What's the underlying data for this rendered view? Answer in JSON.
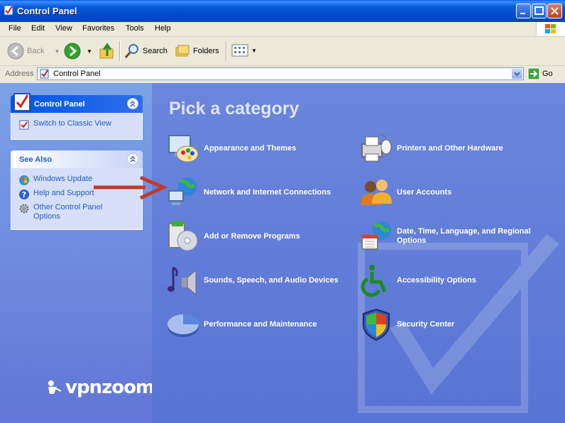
{
  "window": {
    "title": "Control Panel"
  },
  "menu": {
    "items": [
      "File",
      "Edit",
      "View",
      "Favorites",
      "Tools",
      "Help"
    ]
  },
  "toolbar": {
    "back_label": "Back",
    "search_label": "Search",
    "folders_label": "Folders"
  },
  "address": {
    "label": "Address",
    "value": "Control Panel",
    "go_label": "Go"
  },
  "sidebar": {
    "control_panel": {
      "title": "Control Panel",
      "switch_label": "Switch to Classic View"
    },
    "see_also": {
      "title": "See Also",
      "items": [
        {
          "label": "Windows Update",
          "icon": "windows-update-icon"
        },
        {
          "label": "Help and Support",
          "icon": "help-icon"
        },
        {
          "label": "Other Control Panel Options",
          "icon": "gear-icon"
        }
      ]
    }
  },
  "main": {
    "heading": "Pick a category",
    "categories": [
      {
        "label": "Appearance and Themes",
        "icon": "appearance-icon"
      },
      {
        "label": "Printers and Other Hardware",
        "icon": "printer-icon"
      },
      {
        "label": "Network and Internet Connections",
        "icon": "network-icon"
      },
      {
        "label": "User Accounts",
        "icon": "users-icon"
      },
      {
        "label": "Add or Remove Programs",
        "icon": "programs-icon"
      },
      {
        "label": "Date, Time, Language, and Regional Options",
        "icon": "datetime-icon"
      },
      {
        "label": "Sounds, Speech, and Audio Devices",
        "icon": "sound-icon"
      },
      {
        "label": "Accessibility Options",
        "icon": "accessibility-icon"
      },
      {
        "label": "Performance and Maintenance",
        "icon": "performance-icon"
      },
      {
        "label": "Security Center",
        "icon": "shield-icon"
      }
    ]
  },
  "watermark": {
    "text": "vpnzoom"
  },
  "colors": {
    "titlebar": "#0A5BDB",
    "link": "#215DC6",
    "content_bg": "#6680D8",
    "arrow": "#C0392B"
  }
}
